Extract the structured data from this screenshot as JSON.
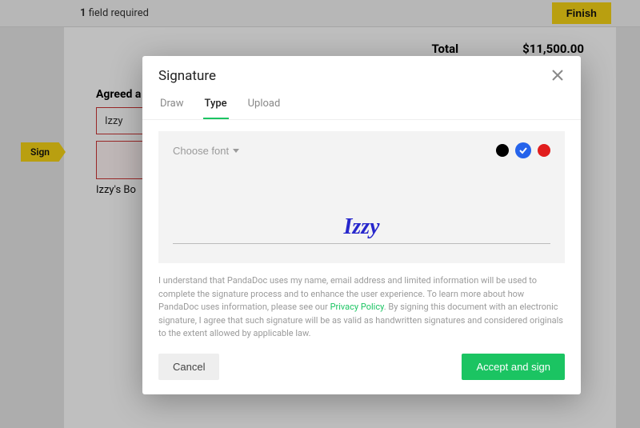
{
  "topbar": {
    "required_count": "1",
    "required_label": " field required",
    "finish": "Finish"
  },
  "doc": {
    "total_label": "Total",
    "total_value": "$11,500.00",
    "agreed_title": "Agreed a",
    "name_value": "Izzy",
    "caption": "Izzy's Bo"
  },
  "sign_tag": "Sign",
  "modal": {
    "title": "Signature",
    "tabs": {
      "draw": "Draw",
      "type": "Type",
      "upload": "Upload"
    },
    "choose_font": "Choose font",
    "signature_text": "Izzy",
    "disclaimer_parts": {
      "p1": "I understand that PandaDoc uses my name, email address and limited information will be used to complete the signature process and to enhance the user experience. To learn more about how PandaDoc uses information, please see our ",
      "link": "Privacy Policy",
      "p2": ". By signing this document with an electronic signature, I agree that such signature will be as valid as handwritten signatures and considered originals to the extent allowed by applicable law."
    },
    "cancel": "Cancel",
    "accept": "Accept and sign"
  },
  "colors": {
    "black": "#000000",
    "blue": "#2563eb",
    "red": "#e11d1d",
    "selected": "blue"
  }
}
